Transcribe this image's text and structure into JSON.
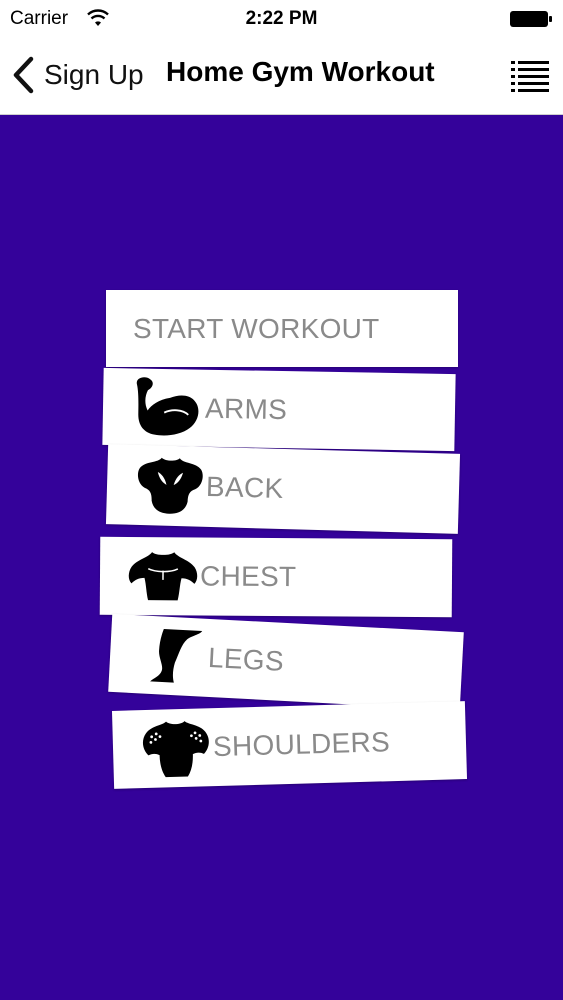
{
  "status_bar": {
    "carrier": "Carrier",
    "time": "2:22 PM",
    "icons": [
      "wifi-icon",
      "battery-icon"
    ]
  },
  "nav": {
    "back_label": "Sign Up",
    "title": "Home Gym Workout",
    "icons": [
      "chevron-left-icon",
      "list-menu-icon"
    ]
  },
  "colors": {
    "background": "#34029a",
    "card": "#ffffff",
    "card_text": "#8a8a8a"
  },
  "menu": {
    "start_label": "START WORKOUT",
    "items": [
      {
        "label": "ARMS",
        "icon": "arms-icon"
      },
      {
        "label": "BACK",
        "icon": "back-icon"
      },
      {
        "label": "CHEST",
        "icon": "chest-icon"
      },
      {
        "label": "LEGS",
        "icon": "legs-icon"
      },
      {
        "label": "SHOULDERS",
        "icon": "shoulders-icon"
      }
    ]
  }
}
